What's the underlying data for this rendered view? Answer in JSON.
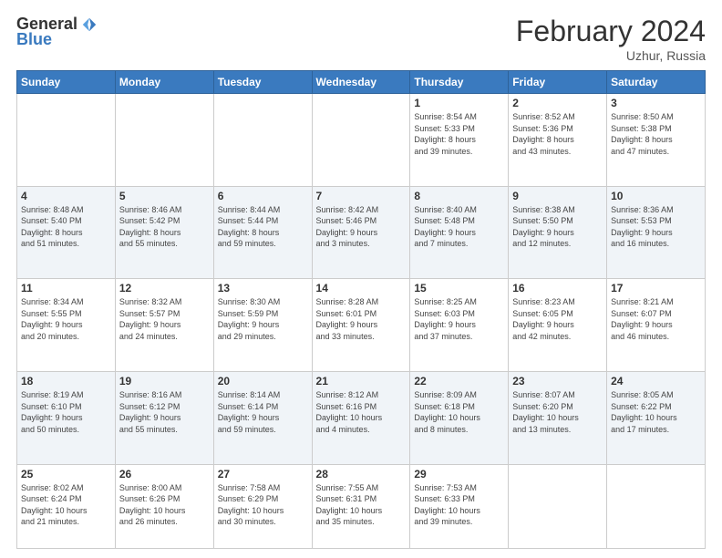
{
  "logo": {
    "general": "General",
    "blue": "Blue"
  },
  "title": {
    "month_year": "February 2024",
    "location": "Uzhur, Russia"
  },
  "headers": [
    "Sunday",
    "Monday",
    "Tuesday",
    "Wednesday",
    "Thursday",
    "Friday",
    "Saturday"
  ],
  "weeks": [
    [
      {
        "day": "",
        "info": ""
      },
      {
        "day": "",
        "info": ""
      },
      {
        "day": "",
        "info": ""
      },
      {
        "day": "",
        "info": ""
      },
      {
        "day": "1",
        "info": "Sunrise: 8:54 AM\nSunset: 5:33 PM\nDaylight: 8 hours\nand 39 minutes."
      },
      {
        "day": "2",
        "info": "Sunrise: 8:52 AM\nSunset: 5:36 PM\nDaylight: 8 hours\nand 43 minutes."
      },
      {
        "day": "3",
        "info": "Sunrise: 8:50 AM\nSunset: 5:38 PM\nDaylight: 8 hours\nand 47 minutes."
      }
    ],
    [
      {
        "day": "4",
        "info": "Sunrise: 8:48 AM\nSunset: 5:40 PM\nDaylight: 8 hours\nand 51 minutes."
      },
      {
        "day": "5",
        "info": "Sunrise: 8:46 AM\nSunset: 5:42 PM\nDaylight: 8 hours\nand 55 minutes."
      },
      {
        "day": "6",
        "info": "Sunrise: 8:44 AM\nSunset: 5:44 PM\nDaylight: 8 hours\nand 59 minutes."
      },
      {
        "day": "7",
        "info": "Sunrise: 8:42 AM\nSunset: 5:46 PM\nDaylight: 9 hours\nand 3 minutes."
      },
      {
        "day": "8",
        "info": "Sunrise: 8:40 AM\nSunset: 5:48 PM\nDaylight: 9 hours\nand 7 minutes."
      },
      {
        "day": "9",
        "info": "Sunrise: 8:38 AM\nSunset: 5:50 PM\nDaylight: 9 hours\nand 12 minutes."
      },
      {
        "day": "10",
        "info": "Sunrise: 8:36 AM\nSunset: 5:53 PM\nDaylight: 9 hours\nand 16 minutes."
      }
    ],
    [
      {
        "day": "11",
        "info": "Sunrise: 8:34 AM\nSunset: 5:55 PM\nDaylight: 9 hours\nand 20 minutes."
      },
      {
        "day": "12",
        "info": "Sunrise: 8:32 AM\nSunset: 5:57 PM\nDaylight: 9 hours\nand 24 minutes."
      },
      {
        "day": "13",
        "info": "Sunrise: 8:30 AM\nSunset: 5:59 PM\nDaylight: 9 hours\nand 29 minutes."
      },
      {
        "day": "14",
        "info": "Sunrise: 8:28 AM\nSunset: 6:01 PM\nDaylight: 9 hours\nand 33 minutes."
      },
      {
        "day": "15",
        "info": "Sunrise: 8:25 AM\nSunset: 6:03 PM\nDaylight: 9 hours\nand 37 minutes."
      },
      {
        "day": "16",
        "info": "Sunrise: 8:23 AM\nSunset: 6:05 PM\nDaylight: 9 hours\nand 42 minutes."
      },
      {
        "day": "17",
        "info": "Sunrise: 8:21 AM\nSunset: 6:07 PM\nDaylight: 9 hours\nand 46 minutes."
      }
    ],
    [
      {
        "day": "18",
        "info": "Sunrise: 8:19 AM\nSunset: 6:10 PM\nDaylight: 9 hours\nand 50 minutes."
      },
      {
        "day": "19",
        "info": "Sunrise: 8:16 AM\nSunset: 6:12 PM\nDaylight: 9 hours\nand 55 minutes."
      },
      {
        "day": "20",
        "info": "Sunrise: 8:14 AM\nSunset: 6:14 PM\nDaylight: 9 hours\nand 59 minutes."
      },
      {
        "day": "21",
        "info": "Sunrise: 8:12 AM\nSunset: 6:16 PM\nDaylight: 10 hours\nand 4 minutes."
      },
      {
        "day": "22",
        "info": "Sunrise: 8:09 AM\nSunset: 6:18 PM\nDaylight: 10 hours\nand 8 minutes."
      },
      {
        "day": "23",
        "info": "Sunrise: 8:07 AM\nSunset: 6:20 PM\nDaylight: 10 hours\nand 13 minutes."
      },
      {
        "day": "24",
        "info": "Sunrise: 8:05 AM\nSunset: 6:22 PM\nDaylight: 10 hours\nand 17 minutes."
      }
    ],
    [
      {
        "day": "25",
        "info": "Sunrise: 8:02 AM\nSunset: 6:24 PM\nDaylight: 10 hours\nand 21 minutes."
      },
      {
        "day": "26",
        "info": "Sunrise: 8:00 AM\nSunset: 6:26 PM\nDaylight: 10 hours\nand 26 minutes."
      },
      {
        "day": "27",
        "info": "Sunrise: 7:58 AM\nSunset: 6:29 PM\nDaylight: 10 hours\nand 30 minutes."
      },
      {
        "day": "28",
        "info": "Sunrise: 7:55 AM\nSunset: 6:31 PM\nDaylight: 10 hours\nand 35 minutes."
      },
      {
        "day": "29",
        "info": "Sunrise: 7:53 AM\nSunset: 6:33 PM\nDaylight: 10 hours\nand 39 minutes."
      },
      {
        "day": "",
        "info": ""
      },
      {
        "day": "",
        "info": ""
      }
    ]
  ]
}
